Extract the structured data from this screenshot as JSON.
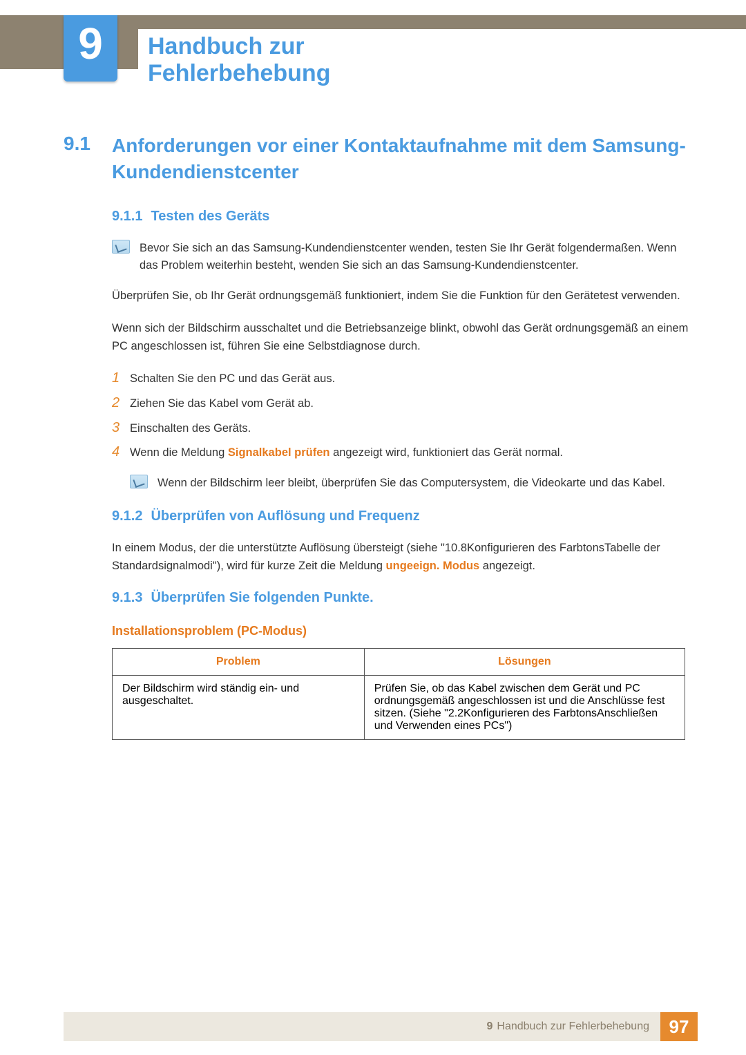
{
  "header": {
    "chapter_number": "9",
    "chapter_title": "Handbuch zur Fehlerbehebung"
  },
  "section": {
    "number": "9.1",
    "title": "Anforderungen vor einer Kontaktaufnahme mit dem Samsung-Kundendienstcenter"
  },
  "sub_911": {
    "number": "9.1.1",
    "title": "Testen des Geräts",
    "note": "Bevor Sie sich an das Samsung-Kundendienstcenter wenden, testen Sie Ihr Gerät folgendermaßen. Wenn das Problem weiterhin besteht, wenden Sie sich an das Samsung-Kundendienstcenter.",
    "p1": "Überprüfen Sie, ob Ihr Gerät ordnungsgemäß funktioniert, indem Sie die Funktion für den Gerätetest verwenden.",
    "p2": "Wenn sich der Bildschirm ausschaltet und die Betriebsanzeige blinkt, obwohl das Gerät ordnungsgemäß an einem PC angeschlossen ist, führen Sie eine Selbstdiagnose durch.",
    "steps": [
      "Schalten Sie den PC und das Gerät aus.",
      "Ziehen Sie das Kabel vom Gerät ab.",
      "Einschalten des Geräts."
    ],
    "step4_prefix": "Wenn die Meldung ",
    "step4_emph": "Signalkabel prüfen",
    "step4_suffix": " angezeigt wird, funktioniert das Gerät normal.",
    "note2": "Wenn der Bildschirm leer bleibt, überprüfen Sie das Computersystem, die Videokarte und das Kabel."
  },
  "sub_912": {
    "number": "9.1.2",
    "title": "Überprüfen von Auflösung und Frequenz",
    "p_prefix": "In einem Modus, der die unterstützte Auflösung übersteigt (siehe \"10.8Konfigurieren des FarbtonsTabelle der Standardsignalmodi\"), wird für kurze Zeit die Meldung ",
    "p_emph": "ungeeign. Modus",
    "p_suffix": " angezeigt."
  },
  "sub_913": {
    "number": "9.1.3",
    "title": "Überprüfen Sie folgenden Punkte.",
    "subhead": "Installationsproblem (PC-Modus)",
    "table": {
      "col1": "Problem",
      "col2": "Lösungen",
      "row1_problem": "Der Bildschirm wird ständig ein- und ausgeschaltet.",
      "row1_solution": "Prüfen Sie, ob das Kabel zwischen dem Gerät und PC ordnungsgemäß angeschlossen ist und die Anschlüsse fest sitzen. (Siehe \"2.2Konfigurieren des FarbtonsAnschließen und Verwenden eines PCs\")"
    }
  },
  "footer": {
    "chapter_num": "9",
    "chapter_label": "Handbuch zur Fehlerbehebung",
    "page": "97"
  },
  "step_numbers": [
    "1",
    "2",
    "3",
    "4"
  ]
}
